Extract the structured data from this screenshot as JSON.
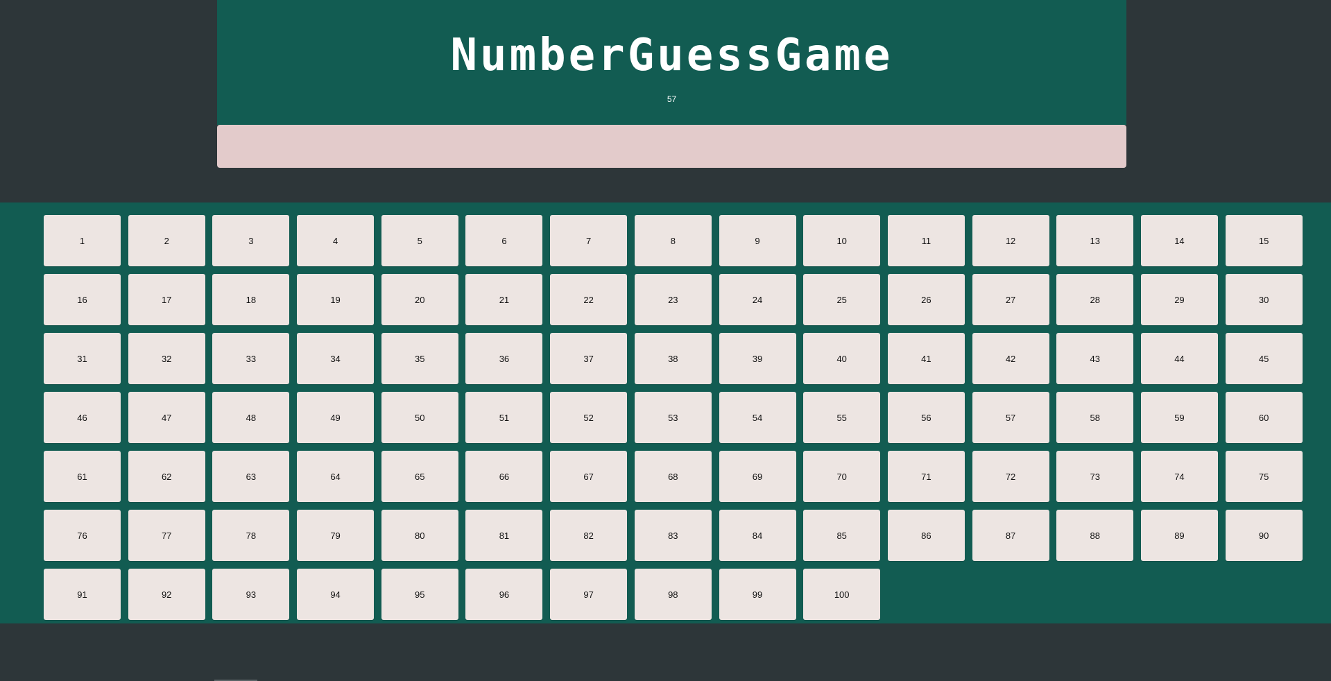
{
  "game": {
    "title": "NumberGuessGame",
    "secret_display": "57",
    "message": ""
  },
  "board": {
    "numbers": [
      1,
      2,
      3,
      4,
      5,
      6,
      7,
      8,
      9,
      10,
      11,
      12,
      13,
      14,
      15,
      16,
      17,
      18,
      19,
      20,
      21,
      22,
      23,
      24,
      25,
      26,
      27,
      28,
      29,
      30,
      31,
      32,
      33,
      34,
      35,
      36,
      37,
      38,
      39,
      40,
      41,
      42,
      43,
      44,
      45,
      46,
      47,
      48,
      49,
      50,
      51,
      52,
      53,
      54,
      55,
      56,
      57,
      58,
      59,
      60,
      61,
      62,
      63,
      64,
      65,
      66,
      67,
      68,
      69,
      70,
      71,
      72,
      73,
      74,
      75,
      76,
      77,
      78,
      79,
      80,
      81,
      82,
      83,
      84,
      85,
      86,
      87,
      88,
      89,
      90,
      91,
      92,
      93,
      94,
      95,
      96,
      97,
      98,
      99,
      100
    ]
  },
  "colors": {
    "background": "#2d3639",
    "panel": "#125c52",
    "message_bar": "#e3cbcb",
    "cell": "#ede5e2"
  }
}
